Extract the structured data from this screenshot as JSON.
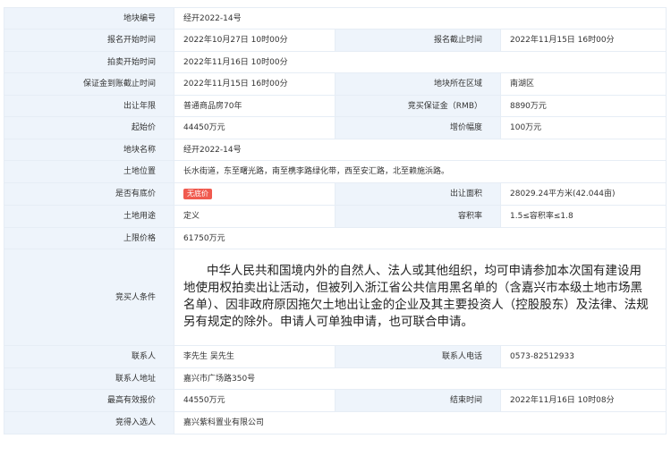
{
  "rows": {
    "parcel_no": {
      "label": "地块编号",
      "value": "经开2022-14号"
    },
    "reg_start": {
      "label": "报名开始时间",
      "value": "2022年10月27日 10时00分"
    },
    "reg_end": {
      "label": "报名截止时间",
      "value": "2022年11月15日 16时00分"
    },
    "auction_start": {
      "label": "拍卖开始时间",
      "value": "2022年11月16日 10时00分"
    },
    "deposit_deadline": {
      "label": "保证金到账截止时间",
      "value": "2022年11月15日 16时00分"
    },
    "area_district": {
      "label": "地块所在区域",
      "value": "南湖区"
    },
    "term": {
      "label": "出让年限",
      "value": "普通商品房70年"
    },
    "deposit": {
      "label": "竞买保证金（RMB）",
      "value": "8890万元"
    },
    "start_price": {
      "label": "起始价",
      "value": "44450万元"
    },
    "increment": {
      "label": "增价幅度",
      "value": "100万元"
    },
    "parcel_name": {
      "label": "地块名称",
      "value": "经开2022-14号"
    },
    "location": {
      "label": "土地位置",
      "value": "长水街道，东至曙光路，南至槜李路绿化带，西至安汇路，北至赖施浜路。"
    },
    "reserve": {
      "label": "是否有底价",
      "value": "无底价"
    },
    "land_area": {
      "label": "出让面积",
      "value": "28029.24平方米(42.044亩)"
    },
    "use": {
      "label": "土地用途",
      "value": "定义"
    },
    "far": {
      "label": "容积率",
      "value": "1.5≤容积率≤1.8"
    },
    "price_cap": {
      "label": "上限价格",
      "value": "61750万元"
    },
    "bidder_req": {
      "label": "竞买人条件",
      "value": "中华人民共和国境内外的自然人、法人或其他组织，均可申请参加本次国有建设用地使用权拍卖出让活动，但被列入浙江省公共信用黑名单的（含嘉兴市本级土地市场黑名单）、因非政府原因拖欠土地出让金的企业及其主要投资人（控股股东）及法律、法规另有规定的除外。申请人可单独申请，也可联合申请。"
    },
    "contact": {
      "label": "联系人",
      "value": "李先生 吴先生"
    },
    "phone": {
      "label": "联系人电话",
      "value": "0573-82512933"
    },
    "address": {
      "label": "联系人地址",
      "value": "嘉兴市广场路350号"
    },
    "top_bid": {
      "label": "最高有效报价",
      "value": "44550万元"
    },
    "end_time": {
      "label": "结束时间",
      "value": "2022年11月16日 10时08分"
    },
    "winner": {
      "label": "竞得入选人",
      "value": "嘉兴紫科置业有限公司"
    }
  },
  "colors": {
    "label_bg": "#eef4fb",
    "border": "#e6edf5",
    "badge_bg": "#f05a4f"
  }
}
